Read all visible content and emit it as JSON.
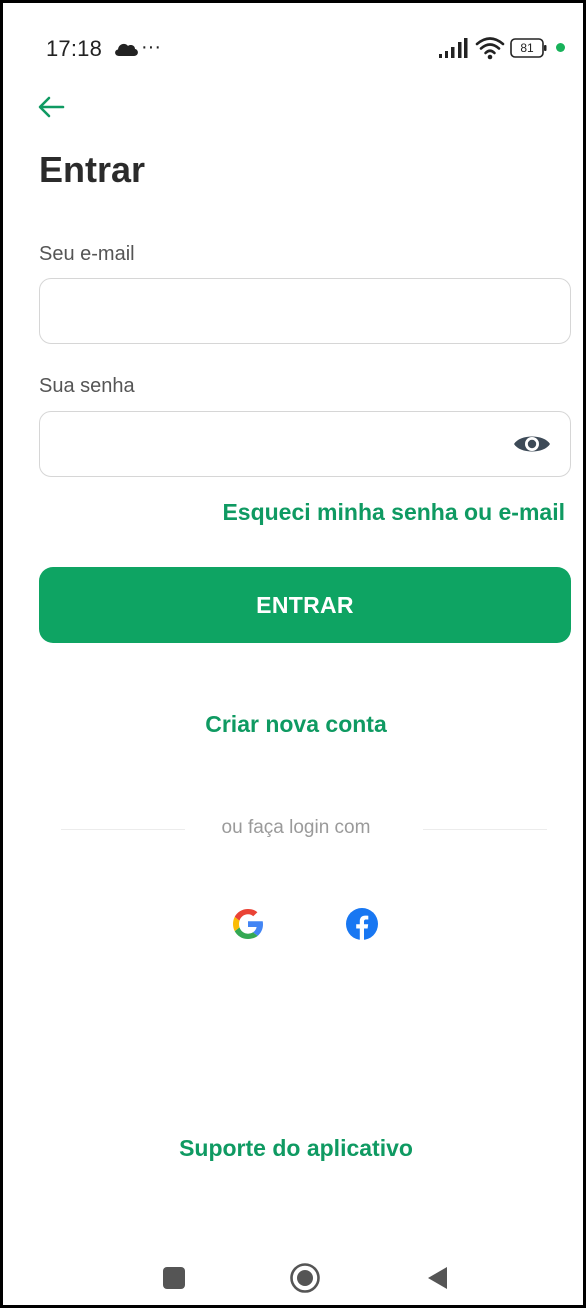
{
  "status_bar": {
    "time": "17:18",
    "more": "···",
    "battery": "81",
    "icons": [
      "cloud-icon",
      "signal-icon",
      "wifi-icon",
      "battery-icon"
    ],
    "dot_color": "#18b25a"
  },
  "header": {
    "back_icon": "arrow-left-icon",
    "title": "Entrar"
  },
  "form": {
    "email_label": "Seu e-mail",
    "email_value": "",
    "email_placeholder": "",
    "password_label": "Sua senha",
    "password_value": "",
    "password_placeholder": "",
    "password_toggle_icon": "eye-icon",
    "forgot_link": "Esqueci minha senha ou e-mail",
    "submit_label": "ENTRAR"
  },
  "create_account_link": "Criar nova conta",
  "social": {
    "divider_text": "ou faça login com",
    "providers": [
      "google-icon",
      "facebook-icon"
    ]
  },
  "support_link": "Suporte do aplicativo",
  "system_nav": [
    "recent-apps-icon",
    "home-icon",
    "back-triangle-icon"
  ],
  "colors": {
    "accent": "#0ea463",
    "link": "#0f9a62",
    "title": "#2b2b2b"
  }
}
